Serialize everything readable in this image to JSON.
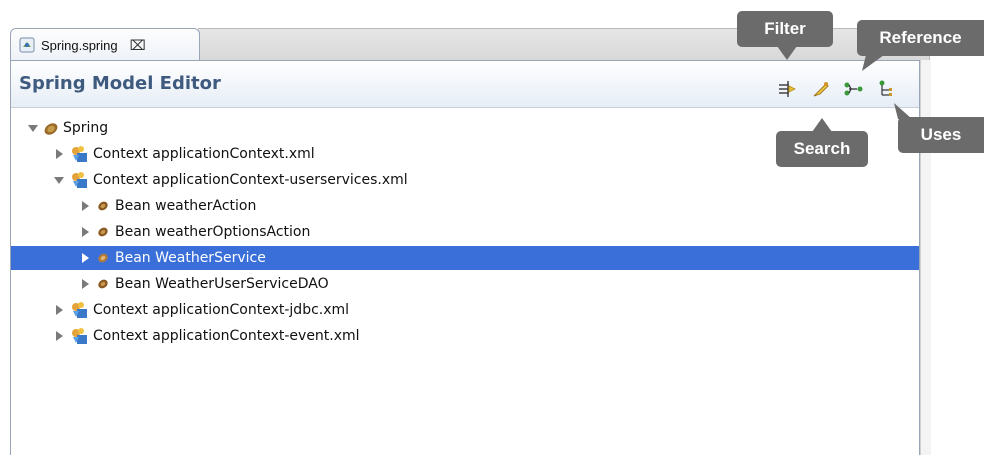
{
  "tab": {
    "label": "Spring.spring",
    "close_glyph": "⌧"
  },
  "editor": {
    "title": "Spring Model Editor"
  },
  "toolbar": {
    "filter_icon": "filter-icon",
    "search_icon": "search-icon",
    "reference_icon": "reference-icon",
    "uses_icon": "uses-icon"
  },
  "tree": {
    "root": "Spring",
    "ctx1": "Context applicationContext.xml",
    "ctx2": "Context applicationContext-userservices.xml",
    "bean1": "Bean weatherAction",
    "bean2": "Bean weatherOptionsAction",
    "bean3": "Bean WeatherService",
    "bean4": "Bean WeatherUserServiceDAO",
    "ctx3": "Context applicationContext-jdbc.xml",
    "ctx4": "Context applicationContext-event.xml"
  },
  "callouts": {
    "filter": "Filter",
    "reference": "Reference",
    "search": "Search",
    "uses": "Uses"
  },
  "colors": {
    "selection": "#3a6fd9",
    "title": "#3f5a7f",
    "callout": "#6b6b6b"
  }
}
